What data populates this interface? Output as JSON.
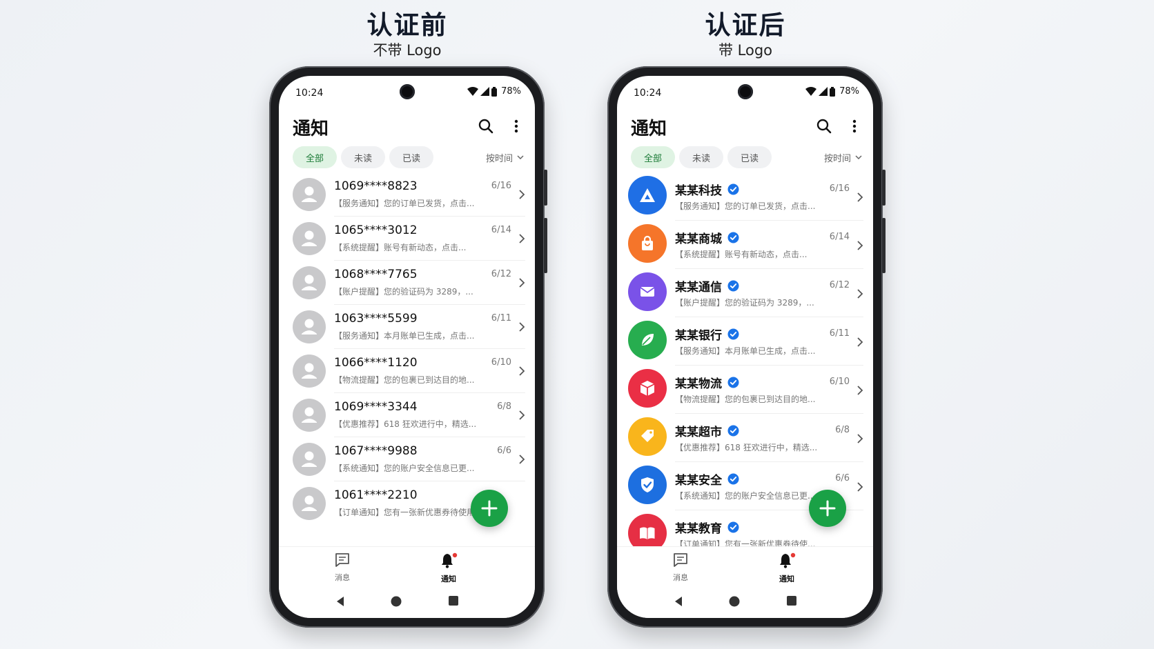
{
  "left": {
    "title": "认证前",
    "subtitle": "不带 Logo",
    "status": {
      "time": "10:24",
      "battery": "78%"
    },
    "app_title": "通知",
    "filters": [
      "全部",
      "未读",
      "已读"
    ],
    "sort_label": "按时间",
    "rows": [
      {
        "name": "1069****8823",
        "date": "6/16",
        "preview": "【服务通知】您的订单已发货，点击..."
      },
      {
        "name": "1065****3012",
        "date": "6/14",
        "preview": "【系统提醒】账号有新动态，点击..."
      },
      {
        "name": "1068****7765",
        "date": "6/12",
        "preview": "【账户提醒】您的验证码为 3289，..."
      },
      {
        "name": "1063****5599",
        "date": "6/11",
        "preview": "【服务通知】本月账单已生成，点击..."
      },
      {
        "name": "1066****1120",
        "date": "6/10",
        "preview": "【物流提醒】您的包裹已到达目的地..."
      },
      {
        "name": "1069****3344",
        "date": "6/8",
        "preview": "【优惠推荐】618 狂欢进行中，精选..."
      },
      {
        "name": "1067****9988",
        "date": "6/6",
        "preview": "【系统通知】您的账户安全信息已更..."
      },
      {
        "name": "1061****2210",
        "date": "",
        "preview": "【订单通知】您有一张新优惠券待使用"
      }
    ],
    "nav": {
      "messages": "消息",
      "notifications": "通知"
    }
  },
  "right": {
    "title": "认证后",
    "subtitle": "带 Logo",
    "status": {
      "time": "10:24",
      "battery": "78%"
    },
    "app_title": "通知",
    "filters": [
      "全部",
      "未读",
      "已读"
    ],
    "sort_label": "按时间",
    "rows": [
      {
        "name": "某某科技",
        "date": "6/16",
        "preview": "【服务通知】您的订单已发货，点击...",
        "color": "#1f6fe5",
        "icon": "triangle-logo-icon"
      },
      {
        "name": "某某商城",
        "date": "6/14",
        "preview": "【系统提醒】账号有新动态，点击...",
        "color": "#f5752a",
        "icon": "shopping-bag-icon"
      },
      {
        "name": "某某通信",
        "date": "6/12",
        "preview": "【账户提醒】您的验证码为 3289，...",
        "color": "#7a52e8",
        "icon": "envelope-icon"
      },
      {
        "name": "某某银行",
        "date": "6/11",
        "preview": "【服务通知】本月账单已生成，点击...",
        "color": "#27ad4f",
        "icon": "leaf-icon"
      },
      {
        "name": "某某物流",
        "date": "6/10",
        "preview": "【物流提醒】您的包裹已到达目的地...",
        "color": "#ea2f45",
        "icon": "package-cube-icon"
      },
      {
        "name": "某某超市",
        "date": "6/8",
        "preview": "【优惠推荐】618 狂欢进行中，精选...",
        "color": "#f9b51c",
        "icon": "price-tag-icon"
      },
      {
        "name": "某某安全",
        "date": "6/6",
        "preview": "【系统通知】您的账户安全信息已更...",
        "color": "#1d6fe0",
        "icon": "shield-check-icon"
      },
      {
        "name": "某某教育",
        "date": "",
        "preview": "【订单通知】您有一张新优惠券待使...",
        "color": "#e62f44",
        "icon": "open-book-icon"
      }
    ],
    "nav": {
      "messages": "消息",
      "notifications": "通知"
    }
  },
  "colors": {
    "accent_green": "#1aa146",
    "verified_blue": "#1a73e8",
    "badge_red": "#e53935"
  }
}
